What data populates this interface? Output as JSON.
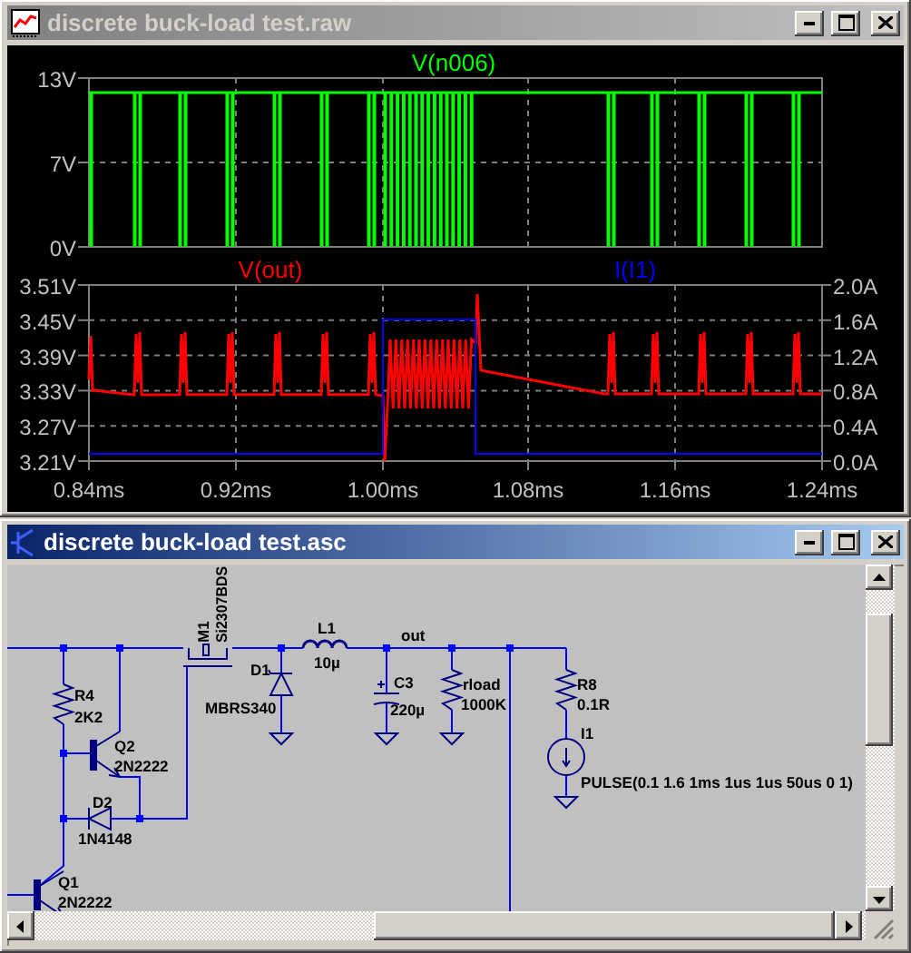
{
  "waveform_window": {
    "title": "discrete buck-load test.raw",
    "active": false,
    "panes": [
      {
        "traces": [
          {
            "name": "V(n006)",
            "color": "#00ff00"
          }
        ],
        "left_ticks": [
          "13V",
          "7V",
          "0V"
        ]
      },
      {
        "traces": [
          {
            "name": "V(out)",
            "color": "#ff0000"
          },
          {
            "name": "I(I1)",
            "color": "#0000ff"
          }
        ],
        "left_ticks": [
          "3.51V",
          "3.45V",
          "3.39V",
          "3.33V",
          "3.27V",
          "3.21V"
        ],
        "right_ticks": [
          "2.0A",
          "1.6A",
          "1.2A",
          "0.8A",
          "0.4A",
          "0.0A"
        ]
      }
    ],
    "x_ticks": [
      "0.84ms",
      "0.92ms",
      "1.00ms",
      "1.08ms",
      "1.16ms",
      "1.24ms"
    ]
  },
  "schematic_window": {
    "title": "discrete buck-load test.asc",
    "active": true,
    "net_label": "out",
    "components": [
      {
        "kind": "resistor",
        "ref": "R4",
        "value": "2K2"
      },
      {
        "kind": "npn",
        "ref": "Q2",
        "value": "2N2222"
      },
      {
        "kind": "diode",
        "ref": "D2",
        "value": "1N4148"
      },
      {
        "kind": "npn",
        "ref": "Q1",
        "value": "2N2222"
      },
      {
        "kind": "pmos",
        "ref": "M1",
        "value": "Si2307BDS"
      },
      {
        "kind": "diode",
        "ref": "D1",
        "value": "MBRS340"
      },
      {
        "kind": "inductor",
        "ref": "L1",
        "value": "10µ"
      },
      {
        "kind": "capacitor",
        "ref": "C3",
        "value": "220µ"
      },
      {
        "kind": "resistor",
        "ref": "rload",
        "value": "1000K"
      },
      {
        "kind": "resistor",
        "ref": "R8",
        "value": "0.1R"
      },
      {
        "kind": "current_source",
        "ref": "I1",
        "value": "PULSE(0.1 1.6 1ms 1us 1us 50us 0 1)"
      }
    ]
  }
}
